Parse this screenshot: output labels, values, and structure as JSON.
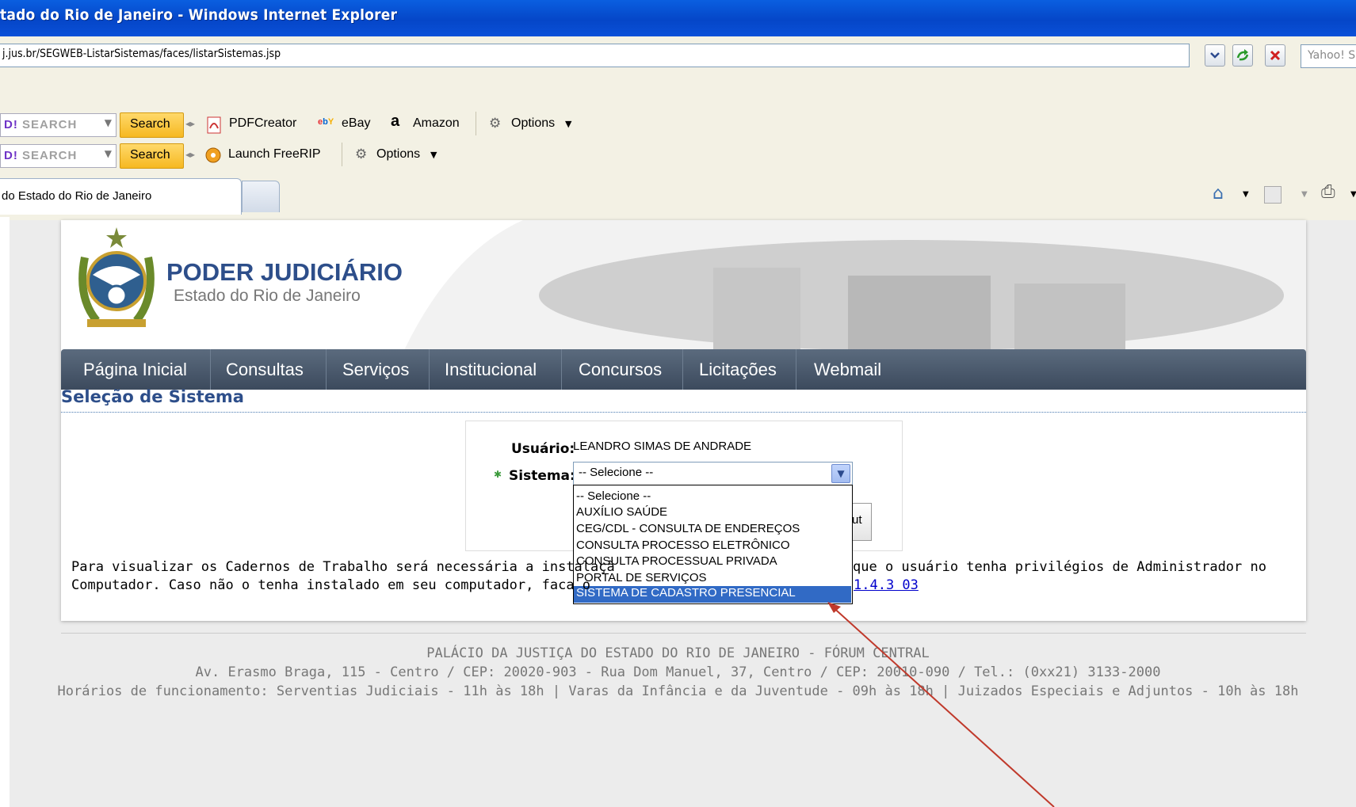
{
  "window": {
    "title": "tado do Rio de Janeiro - Windows Internet Explorer"
  },
  "address": {
    "url": "j.jus.br/SEGWEB-ListarSistemas/faces/listarSistemas.jsp",
    "yahoo_placeholder": "Yahoo! S"
  },
  "toolbar1": {
    "search_label": "SEARCH",
    "search_button": "Search",
    "pdf": "PDFCreator",
    "ebay": "eBay",
    "amazon": "Amazon",
    "options": "Options"
  },
  "toolbar2": {
    "search_label": "SEARCH",
    "search_button": "Search",
    "freerip": "Launch FreeRIP",
    "options": "Options"
  },
  "tab": {
    "label": "do Estado do Rio de Janeiro"
  },
  "brand": {
    "title": "PODER JUDICIÁRIO",
    "subtitle": "Estado do Rio de Janeiro"
  },
  "nav": [
    "Página Inicial",
    "Consultas",
    "Serviços",
    "Institucional",
    "Concursos",
    "Licitações",
    "Webmail"
  ],
  "section": {
    "title": "Seleção de Sistema"
  },
  "form": {
    "user_label": "Usuário:",
    "user_value": "LEANDRO SIMAS DE ANDRADE",
    "system_label": "Sistema:",
    "system_selected": "-- Selecione --",
    "options": [
      "-- Selecione --",
      "AUXÍLIO SAÚDE",
      "CEG/CDL - CONSULTA DE ENDEREÇOS",
      "CONSULTA PROCESSO ELETRÔNICO",
      "CONSULTA PROCESSUAL PRIVADA",
      "PORTAL DE SERVIÇOS",
      "SISTEMA DE CADASTRO PRESENCIAL"
    ],
    "highlighted_option": "SISTEMA DE CADASTRO PRESENCIAL",
    "hidden_button": "ut"
  },
  "notice": {
    "line1_left": "Para visualizar os Cadernos de Trabalho será necessária a instalaçã",
    "line1_right": " que o usuário tenha privilégios de Administrador no",
    "line2_left": "Computador. Caso não o tenha instalado em seu computador, faca o",
    "line2_link": "1.4.3 03"
  },
  "footer": {
    "line1": "PALÁCIO DA JUSTIÇA DO ESTADO DO RIO DE JANEIRO - FÓRUM CENTRAL",
    "line2": "Av. Erasmo Braga, 115 - Centro / CEP: 20020-903 - Rua Dom Manuel, 37, Centro / CEP: 20010-090 / Tel.: (0xx21) 3133-2000",
    "line3": "Horários de funcionamento: Serventias Judiciais - 11h às 18h | Varas da Infância e da Juventude - 09h às 18h | Juizados Especiais e Adjuntos - 10h às 18h"
  },
  "colors": {
    "accent": "#2d4e8a",
    "nav": "#4a5a6e",
    "selection": "#316ac5",
    "annotation_arrow": "#c0392b"
  }
}
